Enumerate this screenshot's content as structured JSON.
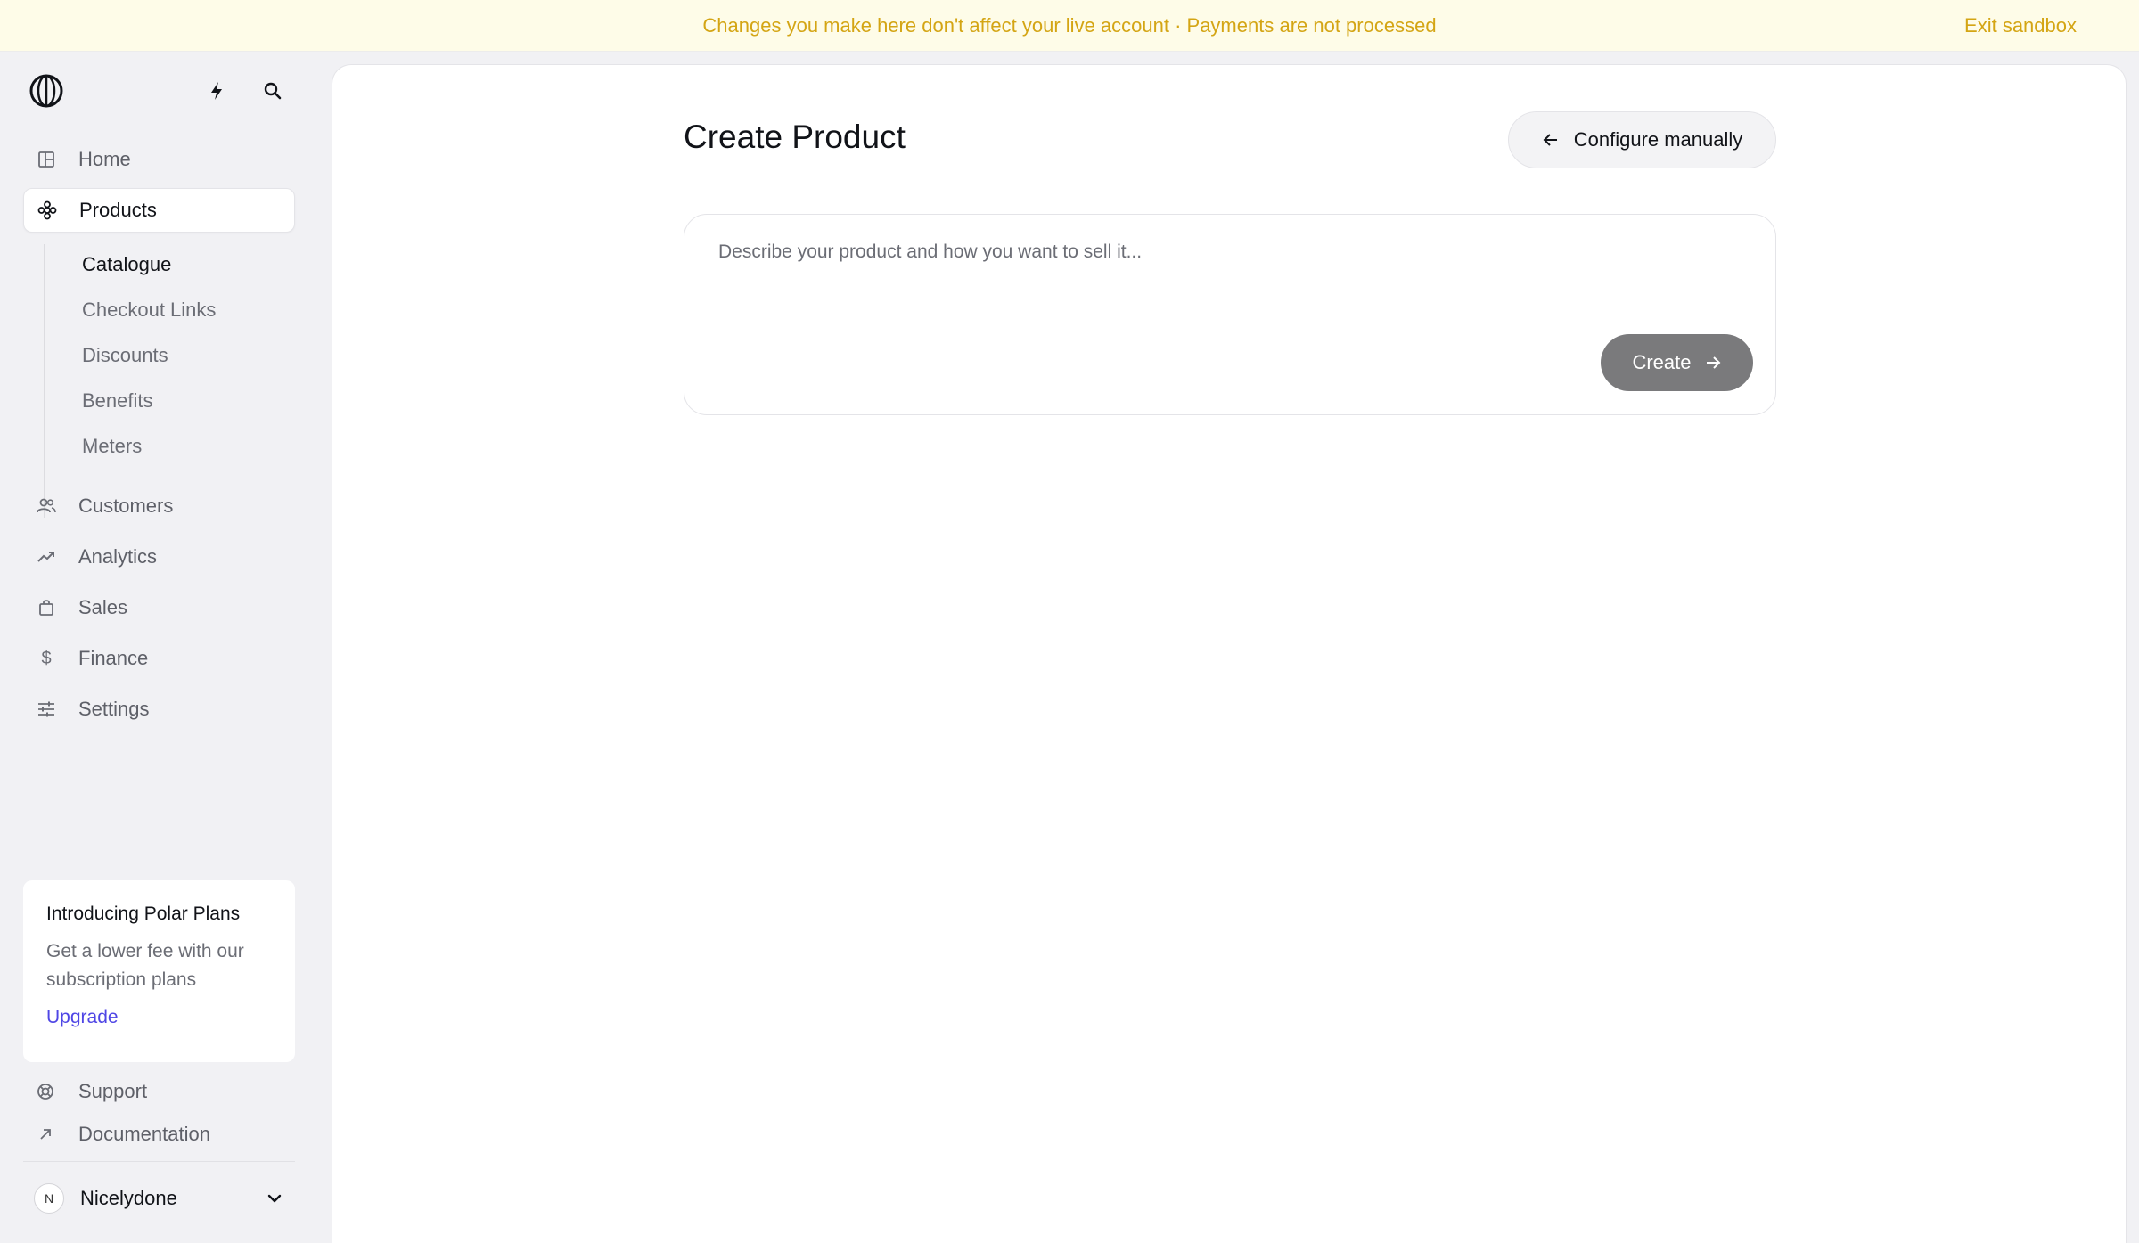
{
  "banner": {
    "message": "Changes you make here don't affect your live account · Payments are not processed",
    "exit_label": "Exit sandbox",
    "color": "#d4a514"
  },
  "sidebar": {
    "top_icons": [
      "polar-logo",
      "bolt-icon",
      "search-icon"
    ],
    "nav": [
      {
        "label": "Home",
        "icon": "home-icon"
      },
      {
        "label": "Products",
        "icon": "products-icon",
        "active": true
      },
      {
        "label": "Customers",
        "icon": "customers-icon"
      },
      {
        "label": "Analytics",
        "icon": "analytics-icon"
      },
      {
        "label": "Sales",
        "icon": "sales-icon"
      },
      {
        "label": "Finance",
        "icon": "dollar-icon"
      },
      {
        "label": "Settings",
        "icon": "sliders-icon"
      }
    ],
    "products_sub": [
      {
        "label": "Catalogue",
        "active": true
      },
      {
        "label": "Checkout Links"
      },
      {
        "label": "Discounts"
      },
      {
        "label": "Benefits"
      },
      {
        "label": "Meters"
      }
    ],
    "promo": {
      "title": "Introducing Polar Plans",
      "description": "Get a lower fee with our subscription plans",
      "cta": "Upgrade",
      "cta_color": "#4f46e5"
    },
    "footer": [
      {
        "label": "Support",
        "icon": "lifebuoy-icon"
      },
      {
        "label": "Documentation",
        "icon": "arrow-up-right-icon"
      }
    ],
    "account": {
      "initial": "N",
      "name": "Nicelydone"
    }
  },
  "main": {
    "title": "Create Product",
    "configure_button": "Configure manually",
    "prompt_placeholder": "Describe your product and how you want to sell it...",
    "prompt_value": "",
    "create_button": "Create"
  }
}
